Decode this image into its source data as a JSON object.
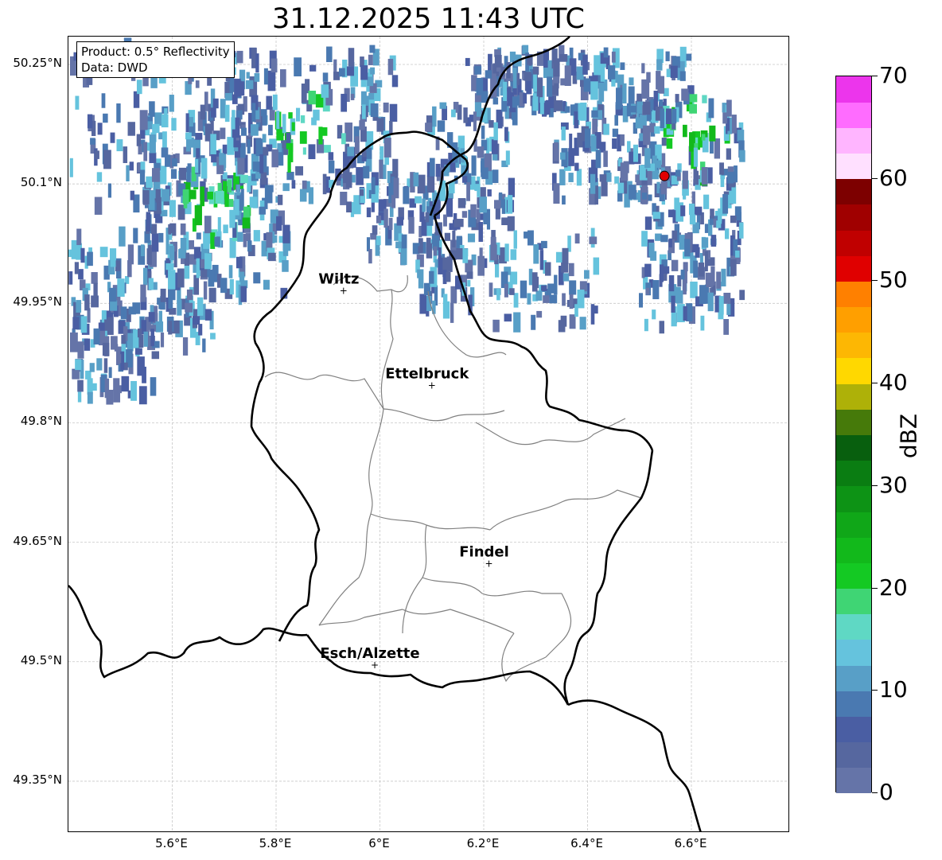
{
  "title": "31.12.2025 11:43 UTC",
  "info": {
    "product": "Product: 0.5° Reflectivity",
    "data": "Data: DWD"
  },
  "axes": {
    "lon_range": [
      5.4,
      6.79
    ],
    "lat_range": [
      49.285,
      50.285
    ],
    "x_ticks": [
      {
        "value": 5.6,
        "label": "5.6°E"
      },
      {
        "value": 5.8,
        "label": "5.8°E"
      },
      {
        "value": 6.0,
        "label": "6°E"
      },
      {
        "value": 6.2,
        "label": "6.2°E"
      },
      {
        "value": 6.4,
        "label": "6.4°E"
      },
      {
        "value": 6.6,
        "label": "6.6°E"
      }
    ],
    "y_ticks": [
      {
        "value": 50.25,
        "label": "50.25°N"
      },
      {
        "value": 50.1,
        "label": "50.1°N"
      },
      {
        "value": 49.95,
        "label": "49.95°N"
      },
      {
        "value": 49.8,
        "label": "49.8°N"
      },
      {
        "value": 49.65,
        "label": "49.65°N"
      },
      {
        "value": 49.5,
        "label": "49.5°N"
      },
      {
        "value": 49.35,
        "label": "49.35°N"
      }
    ],
    "grid": true
  },
  "cities": [
    {
      "name": "Wiltz",
      "lon": 5.93,
      "lat": 49.966
    },
    {
      "name": "Ettelbruck",
      "lon": 6.1,
      "lat": 49.847
    },
    {
      "name": "Findel",
      "lon": 6.21,
      "lat": 49.623
    },
    {
      "name": "Esch/Alzette",
      "lon": 5.99,
      "lat": 49.496
    }
  ],
  "radar_site": {
    "lon": 6.548,
    "lat": 50.11,
    "color": "#e00000"
  },
  "colorbar": {
    "label": "dBZ",
    "min": 0,
    "max": 70,
    "step": 2.5,
    "tick_labels": [
      "0",
      "10",
      "20",
      "30",
      "40",
      "50",
      "60",
      "70"
    ],
    "colors": [
      "#6574a8",
      "#56679f",
      "#4a5ea3",
      "#4a79b1",
      "#589fc7",
      "#65c3dd",
      "#5fd8c4",
      "#3fd574",
      "#14c923",
      "#12b91b",
      "#10a718",
      "#0d9315",
      "#0a7d12",
      "#085f0e",
      "#467a0a",
      "#aeb108",
      "#ffd800",
      "#fdb703",
      "#ff9f00",
      "#ff8000",
      "#e00000",
      "#c00000",
      "#a00000",
      "#7d0000",
      "#ffe0ff",
      "#ffb5ff",
      "#ff6cff",
      "#ec35ec"
    ]
  },
  "borders": {
    "country_color": "#000000",
    "canton_color": "#808080"
  }
}
